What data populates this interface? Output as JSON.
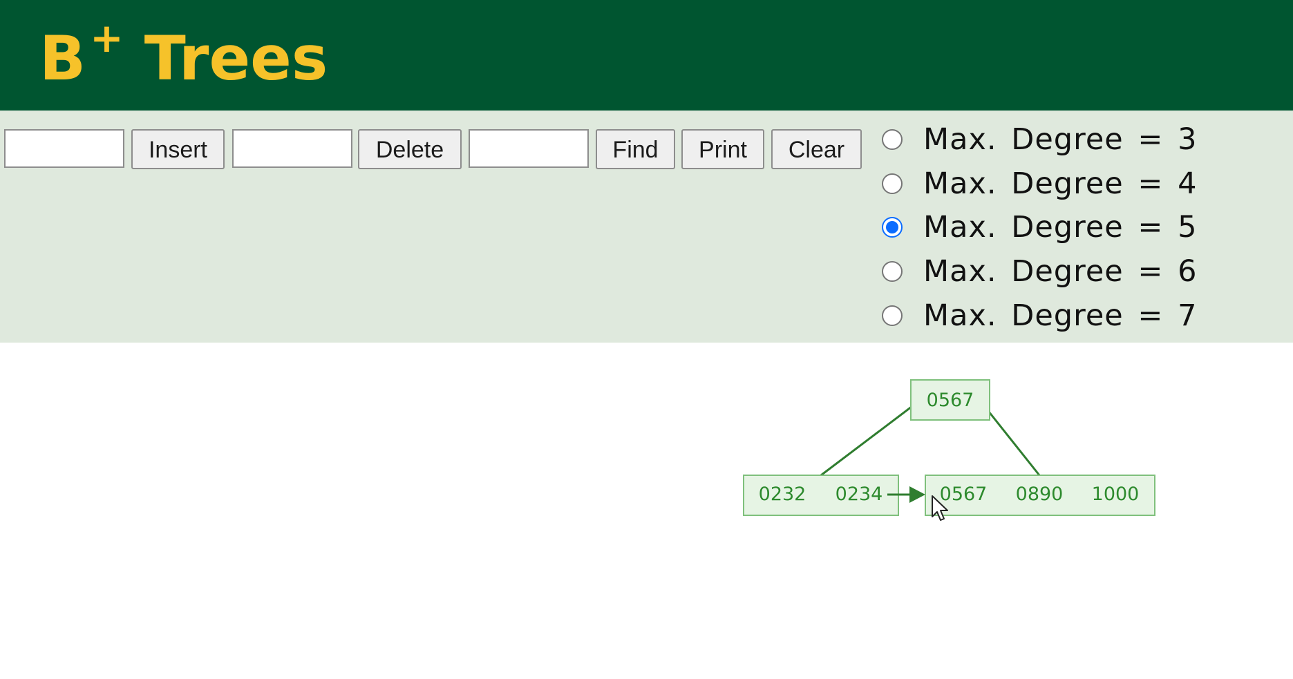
{
  "header": {
    "title_base": "B",
    "title_sup": "+",
    "title_rest": "Trees"
  },
  "toolbar": {
    "insert_value": "",
    "insert_label": "Insert",
    "delete_value": "",
    "delete_label": "Delete",
    "find_value": "",
    "find_label": "Find",
    "print_label": "Print",
    "clear_label": "Clear"
  },
  "degree_options": [
    {
      "label": "Max. Degree = 3",
      "checked": false
    },
    {
      "label": "Max. Degree = 4",
      "checked": false
    },
    {
      "label": "Max. Degree = 5",
      "checked": true
    },
    {
      "label": "Max. Degree = 6",
      "checked": false
    },
    {
      "label": "Max. Degree = 7",
      "checked": false
    }
  ],
  "tree": {
    "root_keys": [
      "0567"
    ],
    "leaves": [
      {
        "keys": [
          "0232",
          "0234"
        ]
      },
      {
        "keys": [
          "0567",
          "0890",
          "1000"
        ]
      }
    ]
  },
  "colors": {
    "header_bg": "#005530",
    "title_color": "#f6c22a",
    "controls_bg": "#dfe9dd",
    "node_fill": "#e6f4e4",
    "node_stroke": "#7fc07c",
    "node_text": "#2d8a2d",
    "edge": "#2f7d2f",
    "radio_checked": "#0b6cff"
  }
}
